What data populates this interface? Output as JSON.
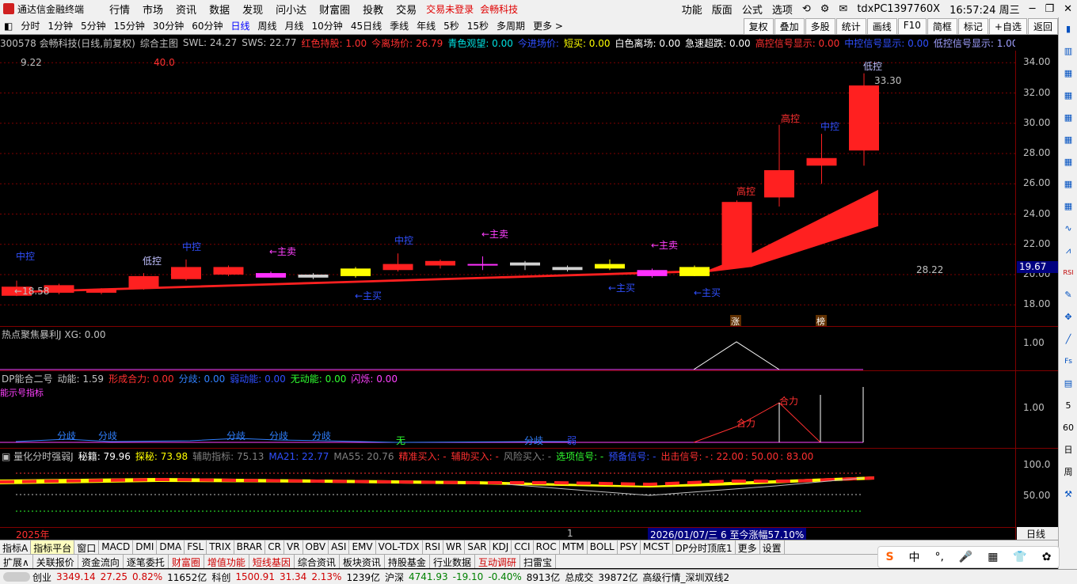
{
  "titlebar": {
    "app_name": "通达信金融终端",
    "menus": [
      "行情",
      "市场",
      "资讯",
      "数据",
      "发现",
      "问小达",
      "财富圈",
      "投教",
      "交易"
    ],
    "status_red": [
      "交易未登录",
      "会畅科技"
    ],
    "right_menus": [
      "功能",
      "版面",
      "公式",
      "选项"
    ],
    "account": "tdxPC1397760X",
    "clock": "16:57:24 周三"
  },
  "periodbar": {
    "periods": [
      "分时",
      "1分钟",
      "5分钟",
      "15分钟",
      "30分钟",
      "60分钟",
      "日线",
      "周线",
      "月线",
      "10分钟",
      "45日线",
      "季线",
      "年线",
      "5秒",
      "15秒",
      "多周期",
      "更多 >"
    ],
    "active": "日线",
    "buttons": [
      "复权",
      "叠加",
      "多股",
      "统计",
      "画线",
      "F10",
      "简框",
      "标记",
      "+自选",
      "返回"
    ]
  },
  "infobar": {
    "items": [
      {
        "t": "300578 会畅科技(日线,前复权)",
        "c": "#c0c0c0"
      },
      {
        "t": "综合主图",
        "c": "#c0c0c0"
      },
      {
        "t": "SWL: 24.27",
        "c": "#c0c0c0"
      },
      {
        "t": "SWS: 22.77",
        "c": "#c0c0c0"
      },
      {
        "t": "红色持股: 1.00",
        "c": "#ff3030"
      },
      {
        "t": "今离场价: 26.79",
        "c": "#ff3030"
      },
      {
        "t": "青色观望: 0.00",
        "c": "#00e0e0"
      },
      {
        "t": "今进场价:",
        "c": "#3050ff"
      },
      {
        "t": "短买: 0.00",
        "c": "#ffff00"
      },
      {
        "t": "白色离场: 0.00",
        "c": "#ffffff"
      },
      {
        "t": "急速超跌: 0.00",
        "c": "#ffffff"
      },
      {
        "t": "高控信号显示: 0.00",
        "c": "#ff3030"
      },
      {
        "t": "中控信号显示: 0.00",
        "c": "#3050ff"
      },
      {
        "t": "低控信号显示: 1.00",
        "c": "#a0a0ff"
      }
    ]
  },
  "main_chart": {
    "top_left_value": "9.22",
    "top_mid_value": "40.0",
    "y_ticks": [
      "34.00",
      "32.00",
      "30.00",
      "28.00",
      "26.00",
      "24.00",
      "22.00",
      "20.00",
      "18.00"
    ],
    "current_price_tag": "19.67",
    "price_label_right": "28.22",
    "low_label": "←18.58",
    "high_label": "33.30",
    "annotations": [
      {
        "t": "中控",
        "c": "#3050ff"
      },
      {
        "t": "低控",
        "c": "#c0c0ff"
      },
      {
        "t": "中控",
        "c": "#3050ff"
      },
      {
        "t": "←主卖",
        "c": "#ff40ff"
      },
      {
        "t": "←主买",
        "c": "#3050ff"
      },
      {
        "t": "中控",
        "c": "#3050ff"
      },
      {
        "t": "←主卖",
        "c": "#ff40ff"
      },
      {
        "t": "←主买",
        "c": "#3050ff"
      },
      {
        "t": "←主卖",
        "c": "#ff40ff"
      },
      {
        "t": "←主买",
        "c": "#3050ff"
      },
      {
        "t": "高控",
        "c": "#ff3030"
      },
      {
        "t": "高控",
        "c": "#ff3030"
      },
      {
        "t": "中控",
        "c": "#3050ff"
      },
      {
        "t": "低控",
        "c": "#c0c0ff"
      }
    ],
    "badges": [
      "涨",
      "榜"
    ]
  },
  "pane1": {
    "title": "热点聚焦暴利J",
    "value": "XG: 0.00",
    "y_tick": "1.00"
  },
  "pane2": {
    "title": "DP能合二号",
    "items": [
      {
        "t": "动能: 1.59",
        "c": "#c0c0c0"
      },
      {
        "t": "形成合力: 0.00",
        "c": "#ff3030"
      },
      {
        "t": "分歧: 0.00",
        "c": "#3080ff"
      },
      {
        "t": "弱动能: 0.00",
        "c": "#3050ff"
      },
      {
        "t": "无动能: 0.00",
        "c": "#30ff30"
      },
      {
        "t": "闪烁: 0.00",
        "c": "#ff40ff"
      }
    ],
    "y_tick": "1.00",
    "labels": [
      {
        "t": "分歧",
        "c": "#3080ff"
      },
      {
        "t": "分歧",
        "c": "#3080ff"
      },
      {
        "t": "分歧",
        "c": "#3080ff"
      },
      {
        "t": "分歧",
        "c": "#3080ff"
      },
      {
        "t": "分歧",
        "c": "#3080ff"
      },
      {
        "t": "无",
        "c": "#30ff30"
      },
      {
        "t": "分歧",
        "c": "#3080ff"
      },
      {
        "t": "弱",
        "c": "#3050ff"
      },
      {
        "t": "合力",
        "c": "#ff3030"
      },
      {
        "t": "合力",
        "c": "#ff3030"
      }
    ],
    "left_text": "能示号指标"
  },
  "pane3": {
    "title": "量化分时强弱J",
    "items": [
      {
        "t": "秘籍: 79.96",
        "c": "#ffffff"
      },
      {
        "t": "探秘: 73.98",
        "c": "#ffff00"
      },
      {
        "t": "辅助指标: 75.13",
        "c": "#808080"
      },
      {
        "t": "MA21: 22.77",
        "c": "#3050ff"
      },
      {
        "t": "MA55: 20.76",
        "c": "#808080"
      },
      {
        "t": "精准买入: -",
        "c": "#ff3030"
      },
      {
        "t": "辅助买入: -",
        "c": "#ff3030"
      },
      {
        "t": "风险买入: -",
        "c": "#808080"
      },
      {
        "t": "选项信号: -",
        "c": "#30ff30"
      },
      {
        "t": "预备信号: -",
        "c": "#3050ff"
      },
      {
        "t": "出击信号: -",
        "c": "#ff3030"
      },
      {
        "t": ": 22.00",
        "c": "#ff3030"
      },
      {
        "t": ": 50.00",
        "c": "#ff3030"
      },
      {
        "t": ": 83.00",
        "c": "#ff3030"
      }
    ],
    "y_ticks": [
      "100.0",
      "50.00"
    ]
  },
  "timebar": {
    "year": "2025年",
    "mark": "1",
    "range_text": "2026/01/07/三 6 至今涨幅57.10%"
  },
  "tabs_row1": [
    "指标A",
    "指标平台",
    "窗口",
    "MACD",
    "DMI",
    "DMA",
    "FSL",
    "TRIX",
    "BRAR",
    "CR",
    "VR",
    "OBV",
    "ASI",
    "EMV",
    "VOL-TDX",
    "RSI",
    "WR",
    "SAR",
    "KDJ",
    "CCI",
    "ROC",
    "MTM",
    "BOLL",
    "PSY",
    "MCST",
    "DP分时顶底1",
    "更多",
    "设置"
  ],
  "tabs_row1_active": "指标平台",
  "tabs_row2": [
    {
      "t": "扩展∧",
      "red": false
    },
    {
      "t": "关联报价",
      "red": false
    },
    {
      "t": "资金流向",
      "red": false
    },
    {
      "t": "逐笔委托",
      "red": false
    },
    {
      "t": "财富圈",
      "red": true
    },
    {
      "t": "增值功能",
      "red": true
    },
    {
      "t": "短线基因",
      "red": true
    },
    {
      "t": "综合资讯",
      "red": false
    },
    {
      "t": "板块资讯",
      "red": false
    },
    {
      "t": "持股基金",
      "red": false
    },
    {
      "t": "行业数据",
      "red": false
    },
    {
      "t": "互动调研",
      "red": true
    },
    {
      "t": "扫雷宝",
      "red": false
    }
  ],
  "right_panel_label": "日线",
  "status": {
    "cy_name": "创业",
    "cy_val": "3349.14",
    "cy_chg": "27.25",
    "cy_pct": "0.82%",
    "cy_amt": "11652亿",
    "kc_name": "科创",
    "kc_val": "1500.91",
    "kc_chg": "31.34",
    "kc_pct": "2.13%",
    "kc_amt": "1239亿",
    "hs_name": "沪深",
    "hs_val": "4741.93",
    "hs_chg": "-19.10",
    "hs_pct": "-0.40%",
    "hs_amt": "8913亿",
    "deal_label": "总成交",
    "deal_val": "39872亿",
    "feed": "高级行情_深圳双线2"
  },
  "ime": {
    "items": [
      "S",
      "中",
      "°,",
      "🎤",
      "▦",
      "👕",
      "✿"
    ]
  },
  "chart_data": {
    "type": "candlestick",
    "candles": [
      {
        "o": 19.2,
        "c": 18.6,
        "h": 19.6,
        "l": 18.58
      },
      {
        "o": 19.3,
        "c": 18.8,
        "h": 19.4,
        "l": 18.7
      },
      {
        "o": 19.0,
        "c": 18.8,
        "h": 19.1,
        "l": 18.7
      },
      {
        "o": 19.1,
        "c": 19.9,
        "h": 20.1,
        "l": 19.0
      },
      {
        "o": 19.7,
        "c": 20.5,
        "h": 21.0,
        "l": 19.6
      },
      {
        "o": 20.0,
        "c": 20.5,
        "h": 20.6,
        "l": 19.9
      },
      {
        "o": 19.8,
        "c": 20.1,
        "h": 20.2,
        "l": 19.8
      },
      {
        "o": 19.8,
        "c": 20.0,
        "h": 20.1,
        "l": 19.7
      },
      {
        "o": 19.9,
        "c": 20.4,
        "h": 20.5,
        "l": 19.8
      },
      {
        "o": 20.3,
        "c": 20.7,
        "h": 21.4,
        "l": 20.2
      },
      {
        "o": 20.6,
        "c": 20.9,
        "h": 21.0,
        "l": 20.4
      },
      {
        "o": 20.6,
        "c": 20.7,
        "h": 21.2,
        "l": 20.3
      },
      {
        "o": 20.6,
        "c": 20.8,
        "h": 20.9,
        "l": 20.3
      },
      {
        "o": 20.3,
        "c": 20.5,
        "h": 20.6,
        "l": 20.2
      },
      {
        "o": 20.4,
        "c": 20.7,
        "h": 21.0,
        "l": 20.3
      },
      {
        "o": 19.9,
        "c": 20.3,
        "h": 20.4,
        "l": 19.8
      },
      {
        "o": 19.9,
        "c": 20.5,
        "h": 20.6,
        "l": 19.9
      },
      {
        "o": 20.5,
        "c": 24.8,
        "h": 24.9,
        "l": 20.5
      },
      {
        "o": 25.1,
        "c": 26.9,
        "h": 29.9,
        "l": 24.5
      },
      {
        "o": 27.7,
        "c": 27.2,
        "h": 29.3,
        "l": 26.0
      },
      {
        "o": 28.2,
        "c": 32.5,
        "h": 33.3,
        "l": 27.2
      }
    ],
    "bar_styles": [
      "r",
      "r",
      "r",
      "r",
      "r",
      "r",
      "m",
      "w",
      "y",
      "r",
      "r",
      "m",
      "w",
      "w",
      "y",
      "m",
      "y",
      "r",
      "r",
      "r",
      "r"
    ],
    "ylim": [
      16.6,
      34.8
    ]
  }
}
